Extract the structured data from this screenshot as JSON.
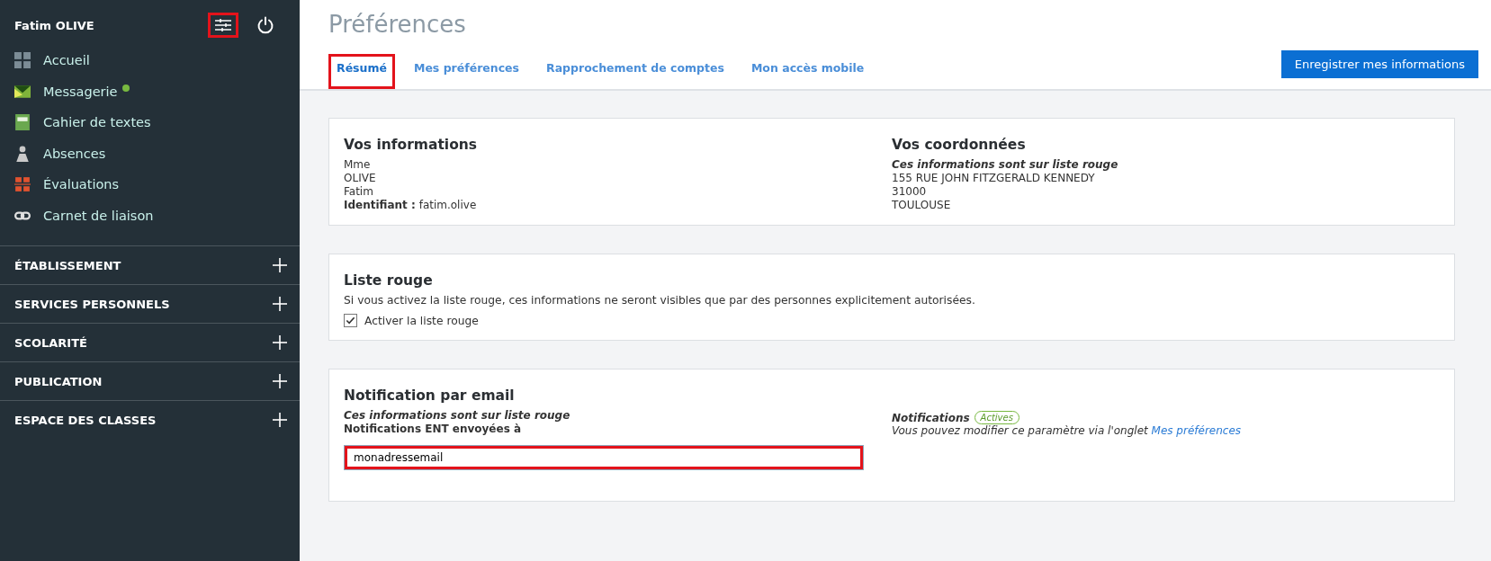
{
  "sidebar": {
    "user_name": "Fatim OLIVE",
    "settings_highlighted": true,
    "items": [
      {
        "label": "Accueil",
        "kind": "grid",
        "badge": false
      },
      {
        "label": "Messagerie",
        "kind": "mail",
        "badge": true
      },
      {
        "label": "Cahier de textes",
        "kind": "book",
        "badge": false
      },
      {
        "label": "Absences",
        "kind": "person",
        "badge": false
      },
      {
        "label": "Évaluations",
        "kind": "grade",
        "badge": false
      },
      {
        "label": "Carnet de liaison",
        "kind": "link",
        "badge": false
      }
    ],
    "sections": [
      {
        "label": "ÉTABLISSEMENT",
        "expanded": false
      },
      {
        "label": "SERVICES PERSONNELS",
        "expanded": false
      },
      {
        "label": "SCOLARITÉ",
        "expanded": false
      },
      {
        "label": "PUBLICATION",
        "expanded": false
      },
      {
        "label": "ESPACE DES CLASSES",
        "expanded": false
      }
    ]
  },
  "header": {
    "title": "Préférences",
    "tabs": [
      {
        "label": "Résumé",
        "selected": true,
        "highlighted": true
      },
      {
        "label": "Mes préférences",
        "selected": false,
        "highlighted": false
      },
      {
        "label": "Rapprochement de comptes",
        "selected": false,
        "highlighted": false
      },
      {
        "label": "Mon accès mobile",
        "selected": false,
        "highlighted": false
      }
    ],
    "save_button": "Enregistrer mes informations"
  },
  "info_card": {
    "left": {
      "title": "Vos informations",
      "lines": [
        "Mme",
        "OLIVE",
        "Fatim"
      ],
      "id_label": "Identifiant :",
      "id_value": "fatim.olive"
    },
    "right": {
      "title": "Vos coordonnées",
      "note": "Ces informations sont sur liste rouge",
      "lines": [
        "155 RUE JOHN FITZGERALD KENNEDY",
        "31000",
        "TOULOUSE"
      ]
    }
  },
  "red_list_card": {
    "title": "Liste rouge",
    "description": "Si vous activez la liste rouge, ces informations ne seront visibles que par des personnes explicitement autorisées.",
    "checkbox": {
      "label": "Activer la liste rouge",
      "checked": true
    }
  },
  "email_card": {
    "title": "Notification par email",
    "note": "Ces informations sont sur liste rouge",
    "field_label": "Notifications ENT envoyées à",
    "email": {
      "value": "monadressemail",
      "highlighted": true
    },
    "notifications_label": "Notifications",
    "status_badge": "Actives",
    "hint": "Vous pouvez modifier ce paramètre via l'onglet",
    "hint_link": "Mes préférences"
  }
}
